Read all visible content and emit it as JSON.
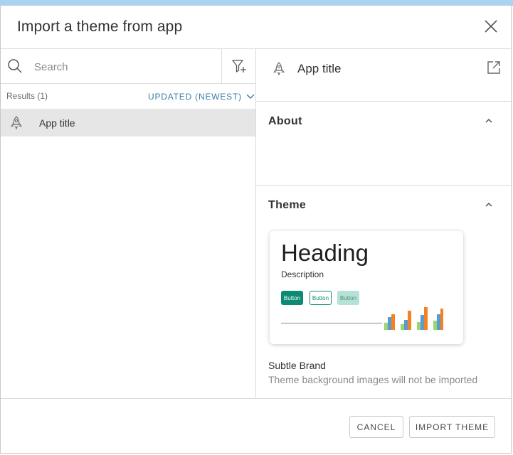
{
  "dialog": {
    "title": "Import a theme from app",
    "close_icon": "close-icon"
  },
  "search": {
    "placeholder": "Search",
    "value": "",
    "icon": "search-icon",
    "filter_icon": "filter-add-icon"
  },
  "results": {
    "count_label": "Results (1)",
    "sort_label": "UPDATED (NEWEST)",
    "sort_icon": "chevron-down-icon",
    "items": [
      {
        "label": "App title",
        "icon": "rocket-icon",
        "selected": true
      }
    ]
  },
  "detail": {
    "app_title": "App title",
    "app_icon": "rocket-icon",
    "open_icon": "open-external-icon",
    "about_header": "About",
    "theme_header": "Theme",
    "collapse_icon": "chevron-up-icon"
  },
  "theme_preview": {
    "heading": "Heading",
    "description": "Description",
    "buttons": [
      "Button",
      "Button",
      "Button"
    ],
    "primary_color": "#0d8a72",
    "light_color": "#b5e2d6",
    "chart_colors": [
      "#9bd76e",
      "#5b9bd5",
      "#f5821f"
    ],
    "chart_values": [
      [
        0.3,
        0.55,
        0.7
      ],
      [
        0.25,
        0.45,
        0.85
      ],
      [
        0.35,
        0.65,
        1.0
      ],
      [
        0.4,
        0.7,
        0.95
      ]
    ]
  },
  "theme": {
    "name": "Subtle Brand",
    "note": "Theme background images will not be imported"
  },
  "footer": {
    "cancel_label": "CANCEL",
    "import_label": "IMPORT THEME"
  }
}
